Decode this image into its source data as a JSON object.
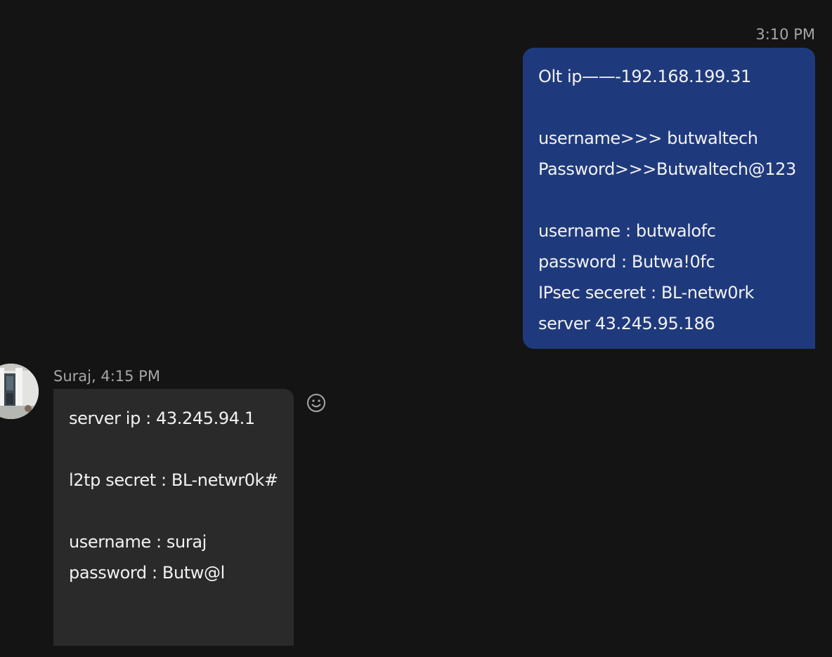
{
  "header": {
    "partial_text": "· · ·"
  },
  "sent_message": {
    "timestamp": "3:10 PM",
    "lines": [
      "Olt ip——-192.168.199.31",
      "",
      "username>>> butwaltech",
      "Password>>>Butwaltech@123",
      "",
      "username : butwalofc",
      "password : Butwa!0fc",
      "IPsec seceret : BL-netw0rk",
      "server 43.245.95.186"
    ],
    "bubble_color": "#1f3a7c"
  },
  "received_message": {
    "sender_meta": "Suraj, 4:15 PM",
    "lines": [
      "server ip : 43.245.94.1",
      "",
      "l2tp secret : BL-netwr0k#",
      "",
      "username : suraj",
      "password : Butw@l"
    ],
    "bubble_color": "#2a2a2a",
    "avatar_icon": "user-avatar-photo",
    "reaction_icon": "smiley-icon"
  },
  "theme": {
    "background": "#141414",
    "meta_text": "#a6a6a6",
    "message_text": "#f2f2f2"
  }
}
